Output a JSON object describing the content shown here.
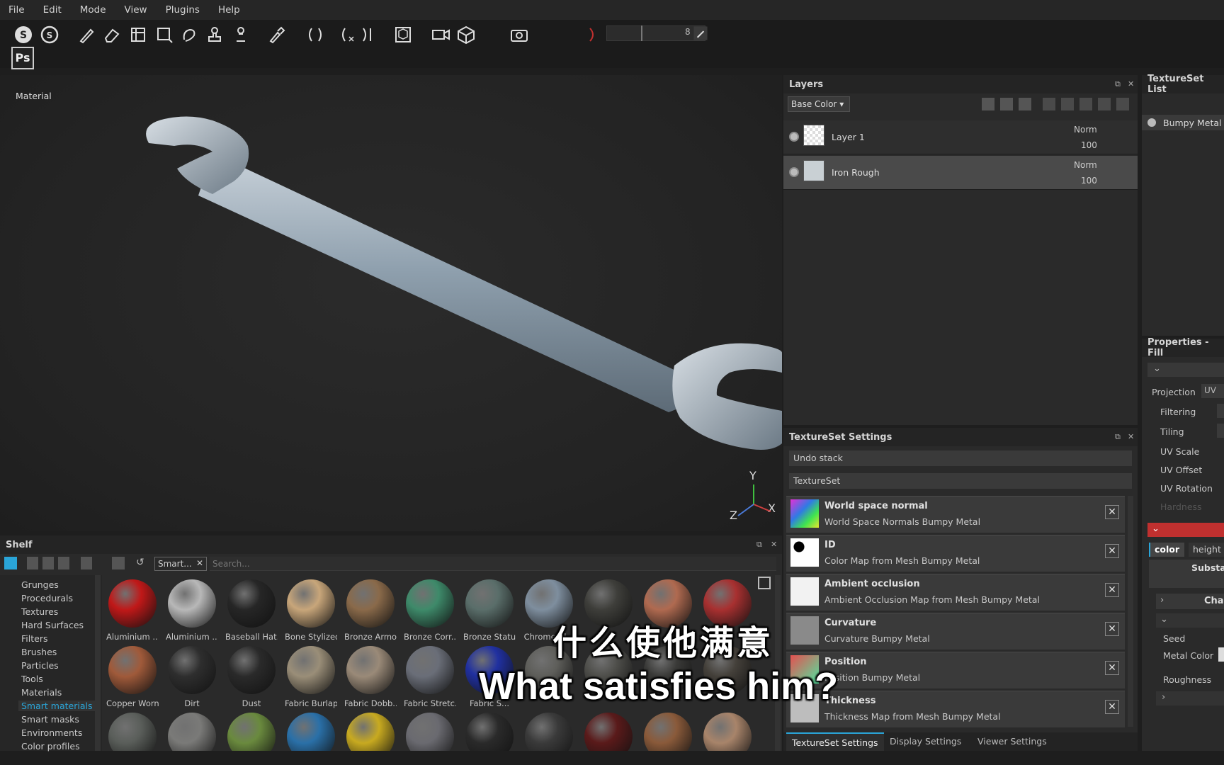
{
  "menu": [
    "File",
    "Edit",
    "Mode",
    "View",
    "Plugins",
    "Help"
  ],
  "toolbar": {
    "value": "8",
    "ps_label": "Ps"
  },
  "viewport": {
    "label": "Material",
    "axes": {
      "y": "Y",
      "x": "X",
      "z": "Z"
    }
  },
  "layers": {
    "title": "Layers",
    "channel_select": "Base Color",
    "items": [
      {
        "name": "Layer 1",
        "blend": "Norm",
        "opacity": "100"
      },
      {
        "name": "Iron Rough",
        "blend": "Norm",
        "opacity": "100"
      }
    ]
  },
  "textureset_list": {
    "title": "TextureSet List",
    "item": "Bumpy Metal"
  },
  "textureset_settings": {
    "title": "TextureSet Settings",
    "undo_stack": "Undo stack",
    "textureset": "TextureSet",
    "channels": [
      {
        "title": "World space normal",
        "subtitle": "World Space Normals Bumpy Metal"
      },
      {
        "title": "ID",
        "subtitle": "Color Map from Mesh Bumpy Metal"
      },
      {
        "title": "Ambient occlusion",
        "subtitle": "Ambient Occlusion Map from Mesh Bumpy Metal"
      },
      {
        "title": "Curvature",
        "subtitle": "Curvature Bumpy Metal"
      },
      {
        "title": "Position",
        "subtitle": "Position Bumpy Metal"
      },
      {
        "title": "Thickness",
        "subtitle": "Thickness Map from Mesh Bumpy Metal"
      }
    ],
    "tabs": [
      "TextureSet Settings",
      "Display Settings",
      "Viewer Settings"
    ]
  },
  "properties": {
    "title": "Properties - Fill",
    "fields": [
      "Projection",
      "Filtering",
      "Tiling",
      "UV Scale",
      "UV Offset",
      "UV Rotation",
      "Hardness"
    ],
    "projection_value": "UV p",
    "tabs": [
      "color",
      "height"
    ],
    "substance": "Substanc",
    "channel": "Cha",
    "params": [
      "Seed",
      "Metal Color",
      "Roughness"
    ]
  },
  "shelf": {
    "title": "Shelf",
    "filter_tag": "Smart...",
    "search_placeholder": "Search...",
    "categories": [
      "Grunges",
      "Procedurals",
      "Textures",
      "Hard Surfaces",
      "Filters",
      "Brushes",
      "Particles",
      "Tools",
      "Materials",
      "Smart materials",
      "Smart masks",
      "Environments",
      "Color profiles"
    ],
    "active_category": "Smart materials",
    "materials_row1": [
      "Aluminium ...",
      "Aluminium ...",
      "Baseball Hat...",
      "Bone Stylized",
      "Bronze Armor",
      "Bronze Corr...",
      "Bronze Statue",
      "Chrome Bl...",
      "",
      "",
      ""
    ],
    "materials_row2": [
      "Copper Worn",
      "Dirt",
      "Dust",
      "Fabric Burlap",
      "Fabric Dobb...",
      "Fabric Stretc...",
      "Fabric S...",
      "",
      "",
      "",
      ""
    ]
  },
  "subtitles": {
    "zh": "什么使他满意",
    "en": "What satisfies him?"
  },
  "colors": {
    "accent": "#2aa5d8",
    "red_bar": "#c0302f"
  }
}
